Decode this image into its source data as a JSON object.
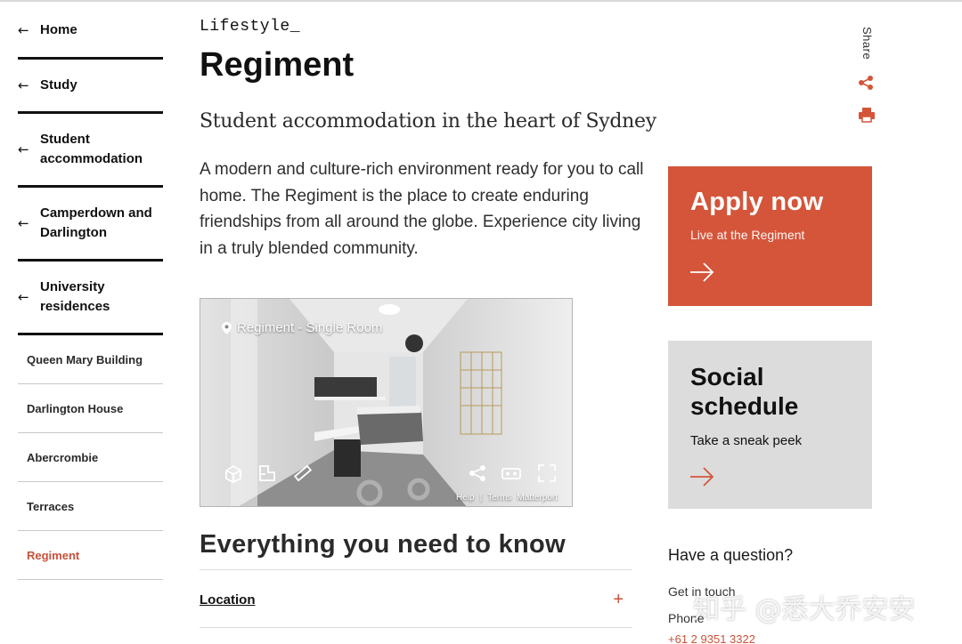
{
  "sidebar": {
    "main": [
      {
        "label": "Home"
      },
      {
        "label": "Study"
      },
      {
        "label": "Student accommodation"
      },
      {
        "label": "Camperdown and Darlington"
      },
      {
        "label": "University residences"
      }
    ],
    "back_arrow": "←",
    "sub": [
      {
        "label": "Queen Mary Building"
      },
      {
        "label": "Darlington House"
      },
      {
        "label": "Abercrombie"
      },
      {
        "label": "Terraces"
      },
      {
        "label": "Regiment",
        "active": true
      }
    ]
  },
  "page": {
    "eyebrow": "Lifestyle_",
    "title": "Regiment",
    "subtitle": "Student accommodation in the heart of Sydney",
    "intro": "A modern and culture-rich environment ready for you to call home. The Regiment is the place to create enduring friendships from all around the globe. Experience city living in a truly blended community."
  },
  "tour": {
    "label": "Regiment - Single Room",
    "footer": {
      "help": "Help",
      "sep": "|",
      "terms": "Terms",
      "brand": "Matterport"
    },
    "controls": [
      "dollhouse-icon",
      "floorplan-icon",
      "measure-icon",
      "share-icon",
      "vr-icon",
      "fullscreen-icon"
    ]
  },
  "section": {
    "heading": "Everything you need to know",
    "accordion": [
      {
        "label": "Location",
        "toggle": "+"
      }
    ]
  },
  "share": {
    "label": "Share",
    "icons": [
      "share-icon",
      "print-icon"
    ]
  },
  "cards": {
    "apply": {
      "title": "Apply now",
      "subtitle": "Live at the Regiment"
    },
    "social": {
      "title": "Social schedule",
      "subtitle": "Take a sneak peek"
    }
  },
  "contact": {
    "heading": "Have a question?",
    "get_in_touch": "Get in touch",
    "phone_label": "Phone",
    "phone": "+61 2 9351 3322"
  },
  "watermark": "知乎 @悉大乔安安",
  "colors": {
    "accent": "#d4553a",
    "text": "#1a1a1a",
    "social_bg": "#dcdcdc"
  }
}
